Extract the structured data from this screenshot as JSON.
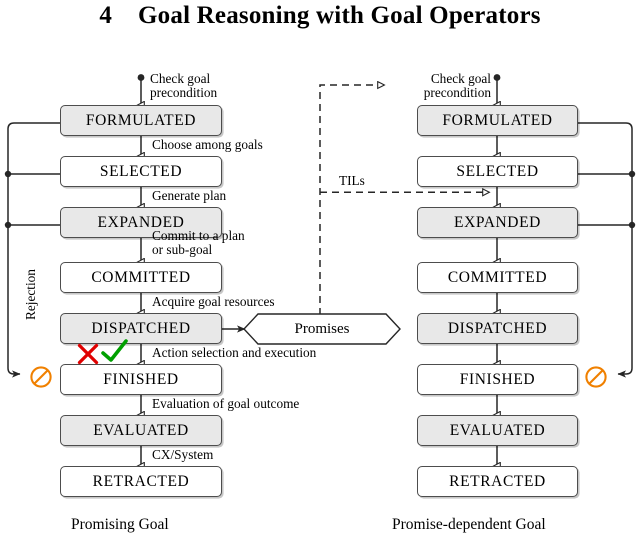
{
  "page_title": {
    "number": "4",
    "text": "Goal Reasoning with Goal Operators"
  },
  "columns": [
    {
      "id": "promising",
      "caption": "Promising Goal",
      "states": [
        {
          "label": "FORMULATED",
          "shaded": true
        },
        {
          "label": "SELECTED",
          "shaded": false
        },
        {
          "label": "EXPANDED",
          "shaded": true
        },
        {
          "label": "COMMITTED",
          "shaded": false
        },
        {
          "label": "DISPATCHED",
          "shaded": true
        },
        {
          "label": "FINISHED",
          "shaded": false
        },
        {
          "label": "EVALUATED",
          "shaded": true
        },
        {
          "label": "RETRACTED",
          "shaded": false
        }
      ],
      "transitions": [
        {
          "line1": "Check goal",
          "line2": "precondition"
        },
        {
          "line1": "Choose among goals",
          "line2": ""
        },
        {
          "line1": "Generate plan",
          "line2": ""
        },
        {
          "line1": "Commit to a plan",
          "line2": "or sub-goal"
        },
        {
          "line1": "Acquire goal resources",
          "line2": ""
        },
        {
          "line1": "Action selection and execution",
          "line2": ""
        },
        {
          "line1": "Evaluation of goal outcome",
          "line2": ""
        },
        {
          "line1": "CX/System",
          "line2": ""
        }
      ],
      "rejection_label": "Rejection"
    },
    {
      "id": "promise-dependent",
      "caption": "Promise-dependent Goal",
      "states": [
        {
          "label": "FORMULATED",
          "shaded": true
        },
        {
          "label": "SELECTED",
          "shaded": false
        },
        {
          "label": "EXPANDED",
          "shaded": true
        },
        {
          "label": "COMMITTED",
          "shaded": false
        },
        {
          "label": "DISPATCHED",
          "shaded": true
        },
        {
          "label": "FINISHED",
          "shaded": false
        },
        {
          "label": "EVALUATED",
          "shaded": true
        },
        {
          "label": "RETRACTED",
          "shaded": false
        }
      ],
      "transitions": [
        {
          "line1": "Check goal",
          "line2": "precondition"
        }
      ]
    }
  ],
  "promises_node": {
    "label": "Promises"
  },
  "tils_label": "TILs",
  "markers": {
    "reject_icon": "prohibition-icon",
    "failure_mark": "red-x-icon",
    "success_mark": "green-check-icon"
  },
  "colors": {
    "box_fill_shaded": "#e8e8e8",
    "box_fill_plain": "#ffffff",
    "box_border": "#4d4d4d",
    "wire": "#262626",
    "prohibition": "#f08000",
    "failure": "#e00000",
    "success": "#00a000"
  }
}
